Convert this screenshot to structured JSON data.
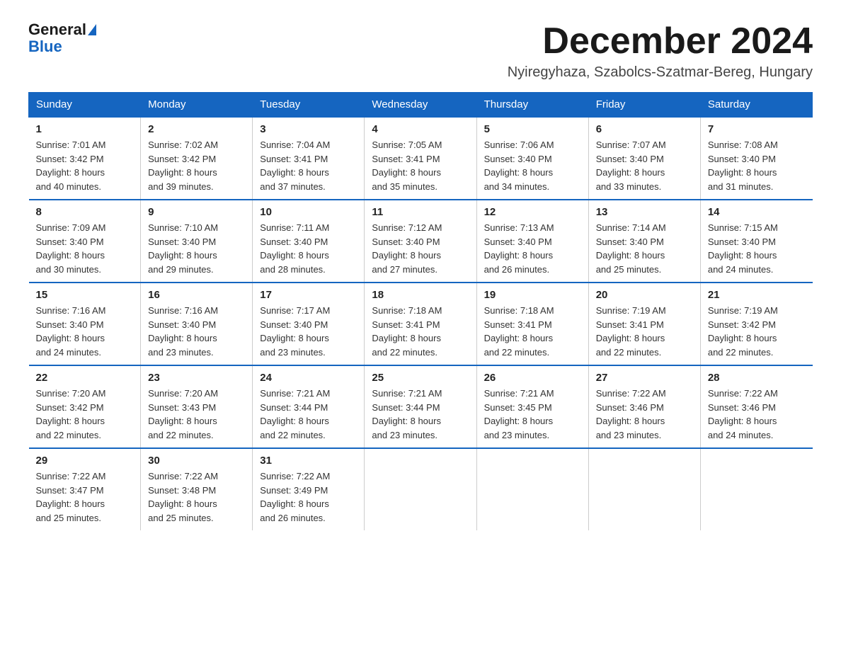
{
  "logo": {
    "general": "General",
    "blue": "Blue",
    "triangle": "▶"
  },
  "header": {
    "month_title": "December 2024",
    "location": "Nyiregyhaza, Szabolcs-Szatmar-Bereg, Hungary"
  },
  "weekdays": [
    "Sunday",
    "Monday",
    "Tuesday",
    "Wednesday",
    "Thursday",
    "Friday",
    "Saturday"
  ],
  "weeks": [
    [
      {
        "day": "1",
        "info": "Sunrise: 7:01 AM\nSunset: 3:42 PM\nDaylight: 8 hours\nand 40 minutes."
      },
      {
        "day": "2",
        "info": "Sunrise: 7:02 AM\nSunset: 3:42 PM\nDaylight: 8 hours\nand 39 minutes."
      },
      {
        "day": "3",
        "info": "Sunrise: 7:04 AM\nSunset: 3:41 PM\nDaylight: 8 hours\nand 37 minutes."
      },
      {
        "day": "4",
        "info": "Sunrise: 7:05 AM\nSunset: 3:41 PM\nDaylight: 8 hours\nand 35 minutes."
      },
      {
        "day": "5",
        "info": "Sunrise: 7:06 AM\nSunset: 3:40 PM\nDaylight: 8 hours\nand 34 minutes."
      },
      {
        "day": "6",
        "info": "Sunrise: 7:07 AM\nSunset: 3:40 PM\nDaylight: 8 hours\nand 33 minutes."
      },
      {
        "day": "7",
        "info": "Sunrise: 7:08 AM\nSunset: 3:40 PM\nDaylight: 8 hours\nand 31 minutes."
      }
    ],
    [
      {
        "day": "8",
        "info": "Sunrise: 7:09 AM\nSunset: 3:40 PM\nDaylight: 8 hours\nand 30 minutes."
      },
      {
        "day": "9",
        "info": "Sunrise: 7:10 AM\nSunset: 3:40 PM\nDaylight: 8 hours\nand 29 minutes."
      },
      {
        "day": "10",
        "info": "Sunrise: 7:11 AM\nSunset: 3:40 PM\nDaylight: 8 hours\nand 28 minutes."
      },
      {
        "day": "11",
        "info": "Sunrise: 7:12 AM\nSunset: 3:40 PM\nDaylight: 8 hours\nand 27 minutes."
      },
      {
        "day": "12",
        "info": "Sunrise: 7:13 AM\nSunset: 3:40 PM\nDaylight: 8 hours\nand 26 minutes."
      },
      {
        "day": "13",
        "info": "Sunrise: 7:14 AM\nSunset: 3:40 PM\nDaylight: 8 hours\nand 25 minutes."
      },
      {
        "day": "14",
        "info": "Sunrise: 7:15 AM\nSunset: 3:40 PM\nDaylight: 8 hours\nand 24 minutes."
      }
    ],
    [
      {
        "day": "15",
        "info": "Sunrise: 7:16 AM\nSunset: 3:40 PM\nDaylight: 8 hours\nand 24 minutes."
      },
      {
        "day": "16",
        "info": "Sunrise: 7:16 AM\nSunset: 3:40 PM\nDaylight: 8 hours\nand 23 minutes."
      },
      {
        "day": "17",
        "info": "Sunrise: 7:17 AM\nSunset: 3:40 PM\nDaylight: 8 hours\nand 23 minutes."
      },
      {
        "day": "18",
        "info": "Sunrise: 7:18 AM\nSunset: 3:41 PM\nDaylight: 8 hours\nand 22 minutes."
      },
      {
        "day": "19",
        "info": "Sunrise: 7:18 AM\nSunset: 3:41 PM\nDaylight: 8 hours\nand 22 minutes."
      },
      {
        "day": "20",
        "info": "Sunrise: 7:19 AM\nSunset: 3:41 PM\nDaylight: 8 hours\nand 22 minutes."
      },
      {
        "day": "21",
        "info": "Sunrise: 7:19 AM\nSunset: 3:42 PM\nDaylight: 8 hours\nand 22 minutes."
      }
    ],
    [
      {
        "day": "22",
        "info": "Sunrise: 7:20 AM\nSunset: 3:42 PM\nDaylight: 8 hours\nand 22 minutes."
      },
      {
        "day": "23",
        "info": "Sunrise: 7:20 AM\nSunset: 3:43 PM\nDaylight: 8 hours\nand 22 minutes."
      },
      {
        "day": "24",
        "info": "Sunrise: 7:21 AM\nSunset: 3:44 PM\nDaylight: 8 hours\nand 22 minutes."
      },
      {
        "day": "25",
        "info": "Sunrise: 7:21 AM\nSunset: 3:44 PM\nDaylight: 8 hours\nand 23 minutes."
      },
      {
        "day": "26",
        "info": "Sunrise: 7:21 AM\nSunset: 3:45 PM\nDaylight: 8 hours\nand 23 minutes."
      },
      {
        "day": "27",
        "info": "Sunrise: 7:22 AM\nSunset: 3:46 PM\nDaylight: 8 hours\nand 23 minutes."
      },
      {
        "day": "28",
        "info": "Sunrise: 7:22 AM\nSunset: 3:46 PM\nDaylight: 8 hours\nand 24 minutes."
      }
    ],
    [
      {
        "day": "29",
        "info": "Sunrise: 7:22 AM\nSunset: 3:47 PM\nDaylight: 8 hours\nand 25 minutes."
      },
      {
        "day": "30",
        "info": "Sunrise: 7:22 AM\nSunset: 3:48 PM\nDaylight: 8 hours\nand 25 minutes."
      },
      {
        "day": "31",
        "info": "Sunrise: 7:22 AM\nSunset: 3:49 PM\nDaylight: 8 hours\nand 26 minutes."
      },
      null,
      null,
      null,
      null
    ]
  ]
}
